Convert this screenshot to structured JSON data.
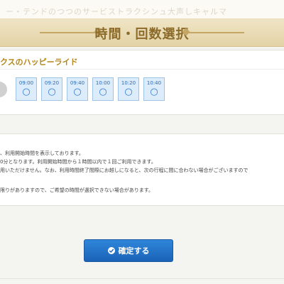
{
  "banner": {
    "text": "ー・テンドのつつのサービストラクシンュ大声しキャルマ"
  },
  "page": {
    "title": "時間・回数選択"
  },
  "ride": {
    "name": "クスのハッピーライド",
    "slots": [
      {
        "time": "09:00",
        "mark": "○"
      },
      {
        "time": "09:20",
        "mark": "○"
      },
      {
        "time": "09:40",
        "mark": "○"
      },
      {
        "time": "10:00",
        "mark": "○"
      },
      {
        "time": "10:20",
        "mark": "○"
      },
      {
        "time": "10:40",
        "mark": "○"
      }
    ]
  },
  "notes": {
    "line1": "、利用開始時間を表示しております。",
    "line2": "0分となります。利用開始時間から１時間以内で１回ご利用できます。",
    "line3": "用いただけません。なお、利用時間終了間際にお越しになると、次の行程に間に合わない場合がございますので",
    "line4": "限りがありますので、ご希望の時間が選択できない場合があります。"
  },
  "confirm": {
    "label": "確定する"
  }
}
